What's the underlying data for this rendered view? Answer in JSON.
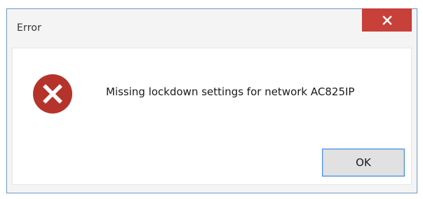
{
  "window": {
    "title": "Error"
  },
  "close_button": {
    "icon": "close-icon",
    "color": "#c7403a"
  },
  "dialog": {
    "icon": "error-icon",
    "icon_color": "#b5332a",
    "message": "Missing lockdown settings for network AC825IP"
  },
  "buttons": {
    "ok_label": "OK"
  }
}
